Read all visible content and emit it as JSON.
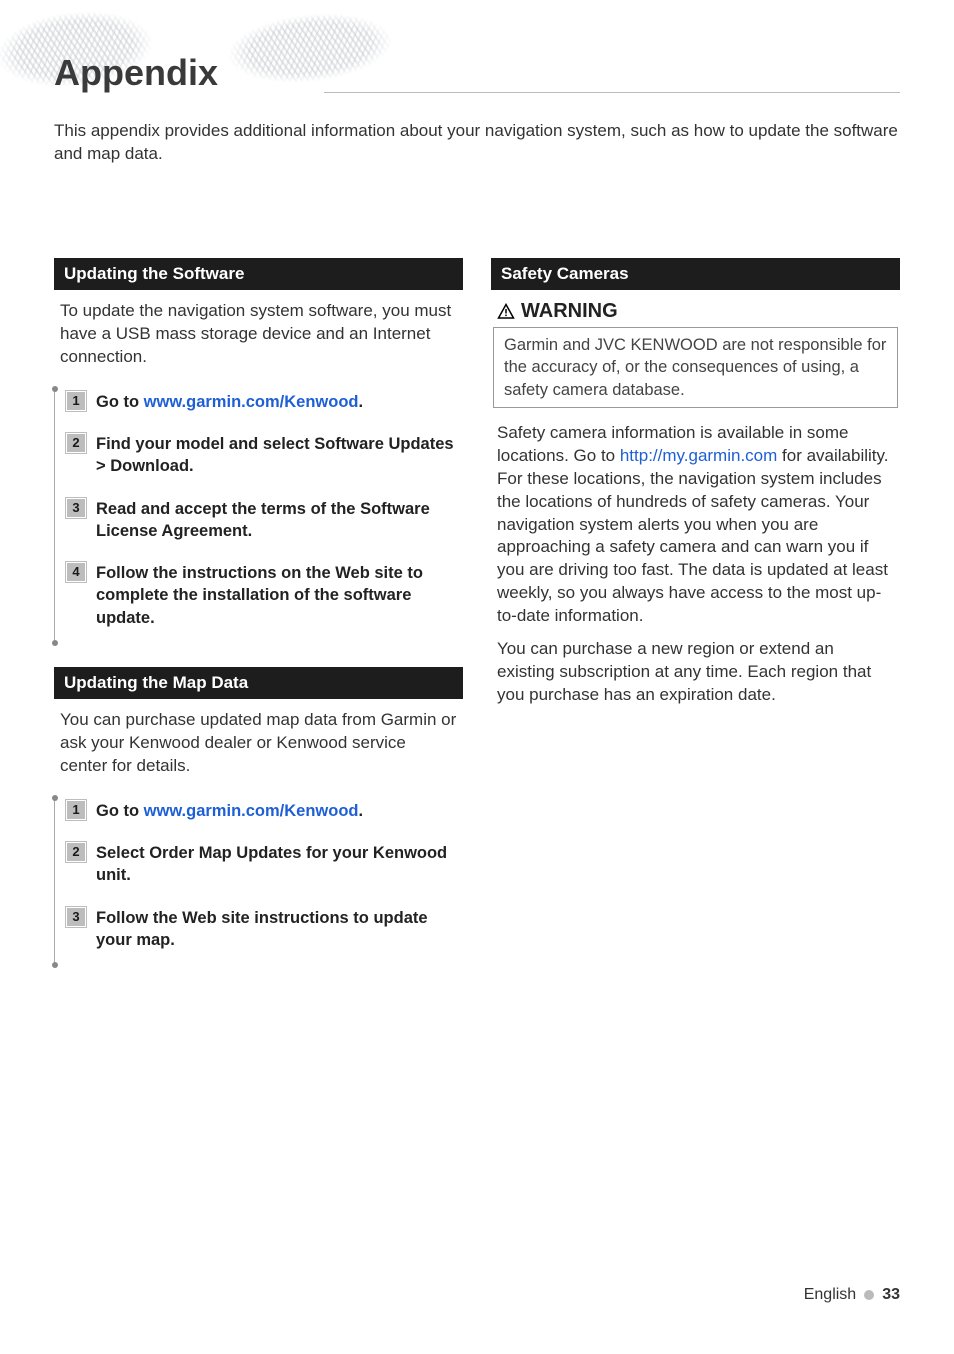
{
  "page": {
    "title": "Appendix",
    "intro": "This appendix provides additional information about your navigation system, such as how to update the software and map data."
  },
  "left": {
    "section1": {
      "heading": "Updating the Software",
      "intro": "To update the navigation system software, you must have a USB mass storage device and an Internet connection.",
      "steps": [
        {
          "num": "1",
          "prefix": "Go to ",
          "link_text": "www.garmin.com/Kenwood",
          "suffix": "."
        },
        {
          "num": "2",
          "text": "Find your model and select Software Updates > Download."
        },
        {
          "num": "3",
          "text": "Read and accept the terms of the Software License Agreement."
        },
        {
          "num": "4",
          "text": "Follow the instructions on the Web site to complete the installation of the software update."
        }
      ]
    },
    "section2": {
      "heading": "Updating the Map Data",
      "intro": "You can purchase updated map data from Garmin or ask your Kenwood dealer or Kenwood service center for details.",
      "steps": [
        {
          "num": "1",
          "prefix": "Go to ",
          "link_text": "www.garmin.com/Kenwood",
          "suffix": "."
        },
        {
          "num": "2",
          "text": "Select Order Map Updates for your Kenwood unit."
        },
        {
          "num": "3",
          "text": "Follow the Web site instructions to update your map."
        }
      ]
    }
  },
  "right": {
    "heading": "Safety Cameras",
    "warning_label": "WARNING",
    "warning_body": "Garmin and JVC KENWOOD are not responsible for the accuracy of, or the consequences of using, a safety camera database.",
    "para1_pre": "Safety camera information is available in some locations. Go to ",
    "para1_link": "http://my.garmin.com",
    "para1_post": " for availability. For these locations, the navigation system includes the locations of hundreds of safety cameras. Your navigation system alerts you when you are approaching a safety camera and can warn you if you are driving too fast. The data is updated at least weekly, so you always have access to the most up-to-date information.",
    "para2": "You can purchase a new region or extend an existing subscription at any time. Each region that you purchase has an expiration date."
  },
  "footer": {
    "language": "English",
    "page_number": "33"
  }
}
